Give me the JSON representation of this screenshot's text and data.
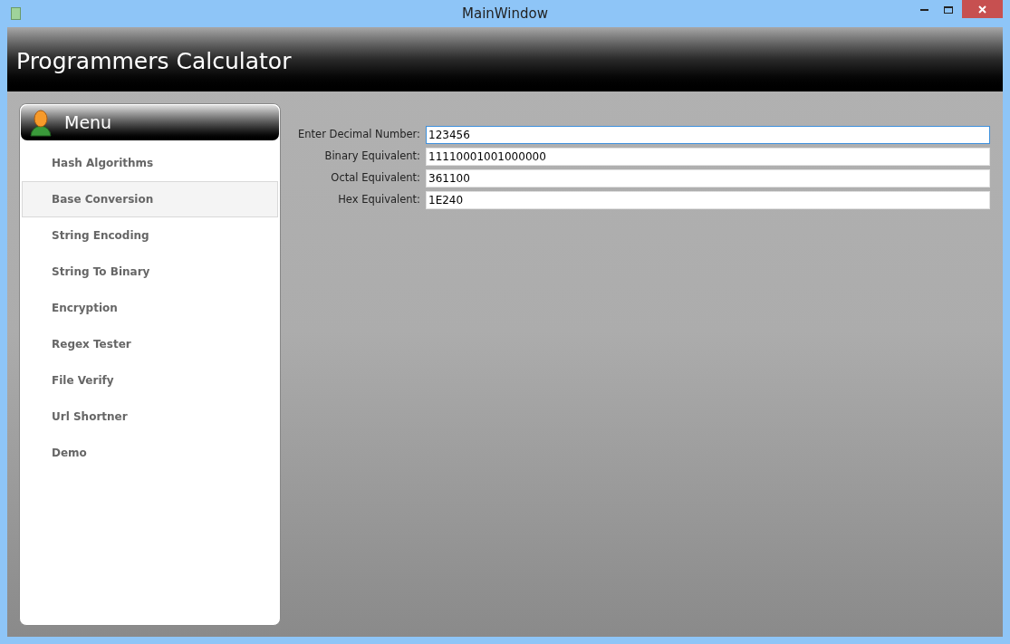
{
  "window": {
    "title": "MainWindow"
  },
  "header": {
    "title": "Programmers Calculator"
  },
  "menu": {
    "title": "Menu",
    "items": [
      {
        "label": "Hash Algorithms",
        "selected": false
      },
      {
        "label": "Base Conversion",
        "selected": true
      },
      {
        "label": "String Encoding",
        "selected": false
      },
      {
        "label": "String To Binary",
        "selected": false
      },
      {
        "label": "Encryption",
        "selected": false
      },
      {
        "label": "Regex Tester",
        "selected": false
      },
      {
        "label": "File Verify",
        "selected": false
      },
      {
        "label": "Url Shortner",
        "selected": false
      },
      {
        "label": "Demo",
        "selected": false
      }
    ]
  },
  "form": {
    "fields": [
      {
        "label": "Enter Decimal Number:",
        "value": "123456",
        "focused": true
      },
      {
        "label": "Binary Equivalent:",
        "value": "11110001001000000",
        "focused": false
      },
      {
        "label": "Octal Equivalent:",
        "value": "361100",
        "focused": false
      },
      {
        "label": "Hex Equivalent:",
        "value": "1E240",
        "focused": false
      }
    ]
  }
}
